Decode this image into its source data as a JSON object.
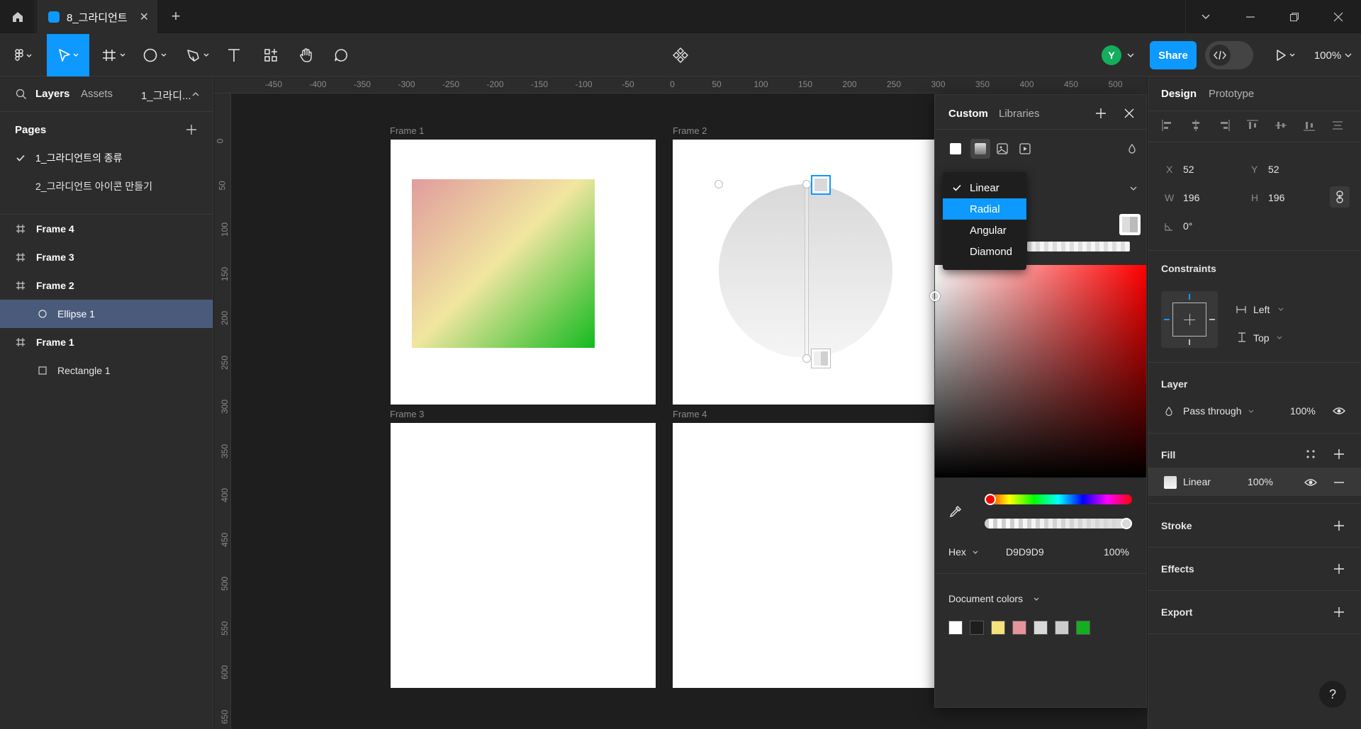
{
  "tabs": {
    "file_tab": "8_그라디언트"
  },
  "toolbar": {
    "avatar_letter": "Y",
    "share_label": "Share",
    "zoom": "100%"
  },
  "left_panel": {
    "tabs": {
      "layers": "Layers",
      "assets": "Assets",
      "page_dropdown": "1_그라디..."
    },
    "pages_title": "Pages",
    "pages": [
      "1_그라디언트의 종류",
      "2_그라디언트 아이콘 만들기"
    ],
    "layers": [
      {
        "name": "Frame 4",
        "type": "frame",
        "indent": 0
      },
      {
        "name": "Frame 3",
        "type": "frame",
        "indent": 0
      },
      {
        "name": "Frame 2",
        "type": "frame",
        "indent": 0
      },
      {
        "name": "Ellipse 1",
        "type": "ellipse",
        "indent": 1,
        "selected": true
      },
      {
        "name": "Frame 1",
        "type": "frame",
        "indent": 0
      },
      {
        "name": "Rectangle 1",
        "type": "rectangle",
        "indent": 1
      }
    ]
  },
  "ruler": {
    "top": [
      "-450",
      "-400",
      "-350",
      "-300",
      "-250",
      "-200",
      "-150",
      "-100",
      "-50",
      "0",
      "50",
      "100",
      "150",
      "200",
      "250",
      "300",
      "350",
      "400",
      "450",
      "500"
    ],
    "left": [
      "0",
      "50",
      "100",
      "150",
      "200",
      "250",
      "300",
      "350",
      "400",
      "450",
      "500",
      "550",
      "600",
      "650"
    ]
  },
  "canvas": {
    "frame1": "Frame 1",
    "frame2": "Frame 2",
    "frame3": "Frame 3",
    "frame4": "Frame 4"
  },
  "picker": {
    "tab_custom": "Custom",
    "tab_libraries": "Libraries",
    "dropdown": [
      "Linear",
      "Radial",
      "Angular",
      "Diamond"
    ],
    "dropdown_checked": "Linear",
    "dropdown_highlighted": "Radial",
    "format": "Hex",
    "hex": "D9D9D9",
    "opacity": "100%",
    "doc_colors_label": "Document colors",
    "doc_colors": [
      "#ffffff",
      "#1e1e1e",
      "#f5e27a",
      "#e4949a",
      "#d9d9d9",
      "#cccccc",
      "#14ae1e"
    ]
  },
  "right_panel": {
    "tab_design": "Design",
    "tab_prototype": "Prototype",
    "x_label": "X",
    "x": "52",
    "y_label": "Y",
    "y": "52",
    "w_label": "W",
    "w": "196",
    "h_label": "H",
    "h": "196",
    "rotation": "0°",
    "constraints_title": "Constraints",
    "constraint_h": "Left",
    "constraint_v": "Top",
    "layer_title": "Layer",
    "blend": "Pass through",
    "layer_opacity": "100%",
    "fill_title": "Fill",
    "fill_type": "Linear",
    "fill_opacity": "100%",
    "stroke_title": "Stroke",
    "effects_title": "Effects",
    "export_title": "Export"
  },
  "help": "?"
}
